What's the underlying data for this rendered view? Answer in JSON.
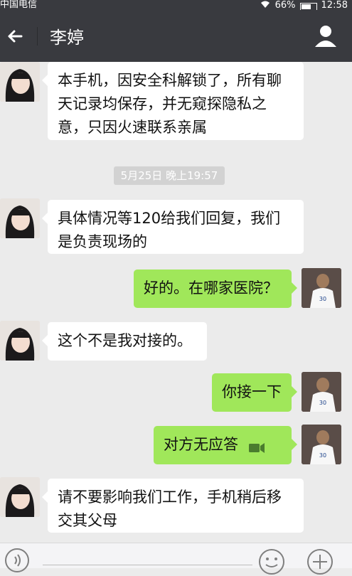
{
  "status_bar": {
    "carrier": "中国电信",
    "battery": "66%",
    "battery_level": 0.66,
    "time": "12:58"
  },
  "header": {
    "title": "李婷",
    "back_icon": "back-arrow-icon",
    "profile_icon": "profile-icon"
  },
  "messages": [
    {
      "side": "left",
      "text": "本手机，因安全科解锁了，所有聊天记录均保存，并无窥探隐私之意，只因火速联系亲属"
    },
    {
      "type": "timestamp",
      "text": "5月25日 晚上19:57"
    },
    {
      "side": "left",
      "text": "具体情况等120给我们回复，我们是负责现场的"
    },
    {
      "side": "right",
      "text": "好的。在哪家医院？"
    },
    {
      "side": "left",
      "text": "这个不是我对接的。"
    },
    {
      "side": "right",
      "text": "你接一下"
    },
    {
      "side": "right",
      "text": "对方无应答",
      "icon": "video-call-icon"
    },
    {
      "side": "left",
      "text": "请不要影响我们工作，手机稍后移交其父母"
    }
  ],
  "colors": {
    "header_bg": "#393a3f",
    "chat_bg": "#ebebeb",
    "bubble_left": "#ffffff",
    "bubble_right": "#a0e75a"
  }
}
